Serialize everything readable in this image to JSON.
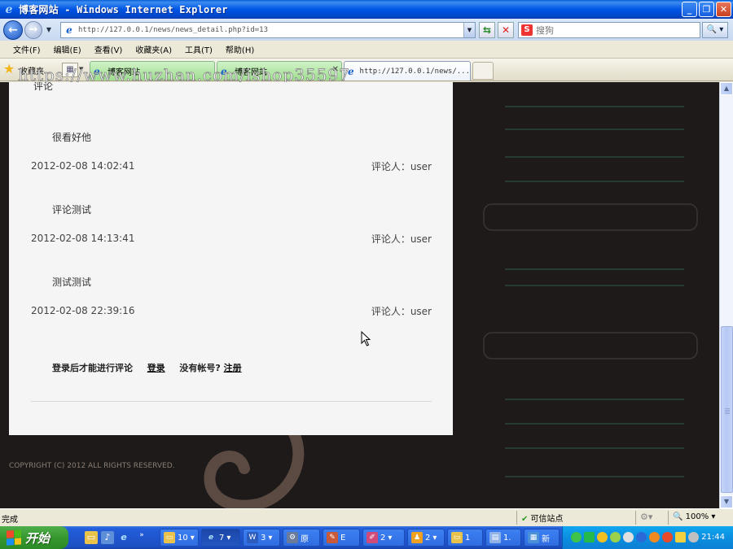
{
  "window": {
    "title": "博客网站 - Windows Internet Explorer",
    "minimize_glyph": "_",
    "maximize_glyph": "❐",
    "close_glyph": "✕"
  },
  "address": {
    "url": "http://127.0.0.1/news/news_detail.php?id=13"
  },
  "search": {
    "placeholder": "搜狗"
  },
  "menu": [
    "文件(F)",
    "编辑(E)",
    "查看(V)",
    "收藏夹(A)",
    "工具(T)",
    "帮助(H)"
  ],
  "favorites": {
    "label": "收藏夹"
  },
  "tabs": [
    {
      "label": "博客网站"
    },
    {
      "label": "博客网站"
    },
    {
      "label": "http://127.0.0.1/news/..."
    }
  ],
  "watermark": "https://www.huzhan.com/ishop35597",
  "page": {
    "cutoff_text": "评论",
    "comments": [
      {
        "text": "很看好他",
        "date": "2012-02-08 14:02:41",
        "commenter": "评论人：user"
      },
      {
        "text": "评论测试",
        "date": "2012-02-08 14:13:41",
        "commenter": "评论人：user"
      },
      {
        "text": "测试测试",
        "date": "2012-02-08 22:39:16",
        "commenter": "评论人：user"
      }
    ],
    "login_prompt": "登录后才能进行评论",
    "login_link": "登录",
    "no_account": "没有帐号?",
    "register_link": "注册",
    "copyright": "COPYRIGHT (C) 2012 ALL RIGHTS RESERVED."
  },
  "status": {
    "text": "完成",
    "zone": "可信站点",
    "zoom": "100%"
  },
  "taskbar": {
    "start_label": "开始",
    "buttons": [
      {
        "label": "10",
        "icon": "folder-icon"
      },
      {
        "label": "7",
        "icon": "ie-icon"
      },
      {
        "label": "3",
        "icon": "word-icon"
      },
      {
        "label": "原",
        "icon": "app-icon"
      },
      {
        "label": "E",
        "icon": "editor-icon"
      },
      {
        "label": "2",
        "icon": "paint-icon"
      },
      {
        "label": "2",
        "icon": "qq-icon"
      },
      {
        "label": "1",
        "icon": "folder-icon"
      },
      {
        "label": "1.",
        "icon": "file-icon"
      },
      {
        "label": "新",
        "icon": "doc-icon"
      }
    ],
    "clock": "21:44"
  },
  "colors": {
    "page_bg": "#1e1a19",
    "panel_bg": "#f5f5f5",
    "accent": "#0055e5",
    "taskbar_start": "#36982f"
  }
}
